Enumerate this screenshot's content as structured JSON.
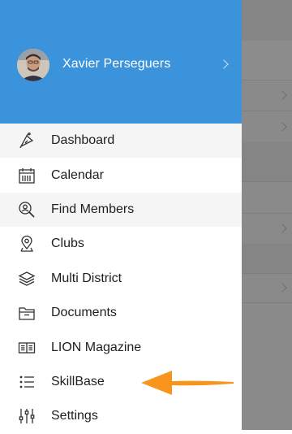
{
  "profile": {
    "name": "Xavier Perseguers"
  },
  "menu": {
    "items": [
      {
        "label": "Dashboard",
        "icon": "dashboard-gauge-icon"
      },
      {
        "label": "Calendar",
        "icon": "calendar-icon"
      },
      {
        "label": "Find Members",
        "icon": "find-members-icon"
      },
      {
        "label": "Clubs",
        "icon": "location-pin-icon"
      },
      {
        "label": "Multi District",
        "icon": "layers-icon"
      },
      {
        "label": "Documents",
        "icon": "folder-icon"
      },
      {
        "label": "LION Magazine",
        "icon": "open-book-icon"
      },
      {
        "label": "SkillBase",
        "icon": "list-icon"
      },
      {
        "label": "Settings",
        "icon": "sliders-icon"
      }
    ]
  },
  "colors": {
    "header": "#3b93dc",
    "annotation_arrow": "#f7951d",
    "backdrop": "#8a8a8a"
  }
}
